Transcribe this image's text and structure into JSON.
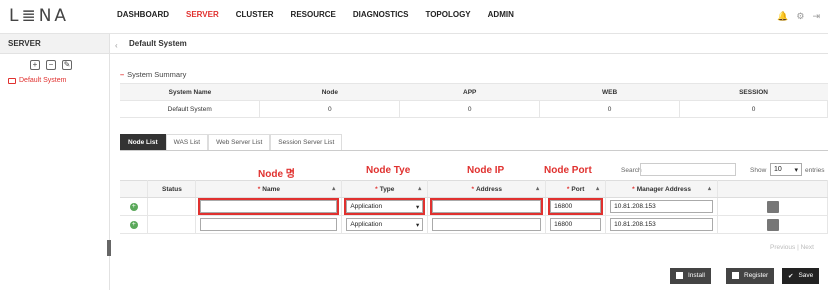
{
  "app": {
    "logo": "L≣NA"
  },
  "nav": [
    "DASHBOARD",
    "SERVER",
    "CLUSTER",
    "RESOURCE",
    "DIAGNOSTICS",
    "TOPOLOGY",
    "ADMIN"
  ],
  "nav_active": "SERVER",
  "sidebar": {
    "title": "SERVER",
    "item": "Default System"
  },
  "breadcrumb": "Default System",
  "summary": {
    "section_title": "System Summary",
    "headers": [
      "System Name",
      "Node",
      "APP",
      "WEB",
      "SESSION"
    ],
    "row": [
      "Default System",
      "0",
      "0",
      "0",
      "0"
    ]
  },
  "tabs": [
    "Node List",
    "WAS List",
    "Web Server List",
    "Session Server List"
  ],
  "annotations": [
    "Node 명",
    "Node Tye",
    "Node IP",
    "Node Port"
  ],
  "search_label": "Search",
  "show_label": "Show",
  "show_value": "10",
  "entries_label": "entries",
  "grid": {
    "headers": [
      "Status",
      "Name",
      "Type",
      "Address",
      "Port",
      "Manager Address"
    ],
    "rows": [
      {
        "name": "",
        "type": "Application",
        "address": "",
        "port": "16800",
        "manager": "10.81.208.153"
      },
      {
        "name": "",
        "type": "Application",
        "address": "",
        "port": "16800",
        "manager": "10.81.208.153"
      }
    ]
  },
  "pager": {
    "previous": "Previous",
    "next": "Next"
  },
  "buttons": {
    "install": "Install",
    "register": "Register",
    "save": "Save"
  }
}
